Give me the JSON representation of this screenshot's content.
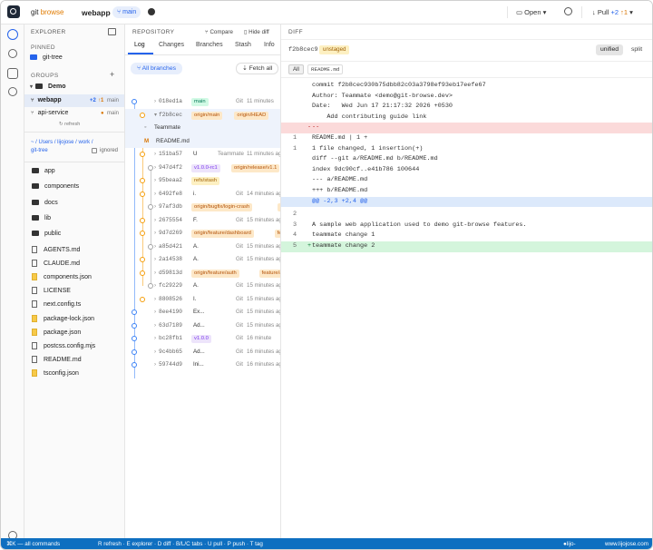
{
  "topbar": {
    "brand_a": "git",
    "brand_b": "browse",
    "repo": "webapp",
    "branch": "main",
    "open": "Open",
    "pull": "Pull",
    "ahead": "+2",
    "behind": "↑1"
  },
  "explorer": {
    "title": "EXPLORER",
    "pinned_label": "PINNED",
    "pinned": "git-tree",
    "groups_label": "GROUPS",
    "group": "Demo",
    "repos": [
      {
        "name": "webapp",
        "ahead": "+2",
        "behind": "↑1",
        "branch": "main"
      },
      {
        "name": "api-service",
        "branch": "main"
      }
    ],
    "refresh": "refresh",
    "path": "~ / Users / lijojose / work / git-tree",
    "ignored": "ignored",
    "folders": [
      "app",
      "components",
      "docs",
      "lib",
      "public"
    ],
    "files": [
      {
        "n": "AGENTS.md",
        "y": false
      },
      {
        "n": "CLAUDE.md",
        "y": false
      },
      {
        "n": "components.json",
        "y": true
      },
      {
        "n": "LICENSE",
        "y": false
      },
      {
        "n": "next.config.ts",
        "y": false
      },
      {
        "n": "package-lock.json",
        "y": true
      },
      {
        "n": "package.json",
        "y": true
      },
      {
        "n": "postcss.config.mjs",
        "y": false
      },
      {
        "n": "README.md",
        "y": false
      },
      {
        "n": "tsconfig.json",
        "y": true
      }
    ]
  },
  "repository": {
    "title": "REPOSITORY",
    "compare": "Compare",
    "hide_diff": "Hide diff",
    "tabs": [
      "Log",
      "Changes",
      "Branches",
      "Stash",
      "Info"
    ],
    "all_branches": "All branches",
    "fetch_all": "Fetch all",
    "commits": [
      {
        "hash": "018ed1a",
        "tags": [
          {
            "t": "main",
            "c": "gr"
          }
        ],
        "msg": "",
        "au": "Git",
        "tm": "11 minutes"
      },
      {
        "hash": "f2b8cec",
        "tags": [
          {
            "t": "origin/main",
            "c": "or"
          },
          {
            "t": "origin/HEAD",
            "c": "or"
          }
        ],
        "msg": "",
        "au": "",
        "tm": "",
        "open": true
      },
      {
        "hash": "151ba57",
        "tags": [],
        "msg": "U",
        "au": "Teammate",
        "tm": "11 minutes ago"
      },
      {
        "hash": "947d4f2",
        "tags": [
          {
            "t": "v1.0.0-rc1",
            "c": "pu"
          },
          {
            "t": "origin/release/v1.1",
            "c": "or"
          }
        ],
        "msg": "",
        "au": "",
        "tm": ""
      },
      {
        "hash": "95beaa2",
        "tags": [
          {
            "t": "refs/stash",
            "c": "ye"
          }
        ],
        "msg": "",
        "au": "",
        "tm": ""
      },
      {
        "hash": "6492fe8",
        "tags": [],
        "msg": "i.",
        "au": "Git",
        "tm": "14 minutes ago"
      },
      {
        "hash": "97af3db",
        "tags": [
          {
            "t": "origin/bugfix/login-crash",
            "c": "or"
          },
          {
            "t": "bugfi",
            "c": "or"
          }
        ],
        "msg": "",
        "au": "",
        "tm": ""
      },
      {
        "hash": "2675554",
        "tags": [],
        "msg": "F.",
        "au": "Git",
        "tm": "15 minutes ago"
      },
      {
        "hash": "9d7d269",
        "tags": [
          {
            "t": "origin/feature/dashboard",
            "c": "or"
          },
          {
            "t": "featur",
            "c": "or"
          }
        ],
        "msg": "",
        "au": "",
        "tm": ""
      },
      {
        "hash": "a85d421",
        "tags": [],
        "msg": "A.",
        "au": "Git",
        "tm": "15 minutes ago"
      },
      {
        "hash": "2a14538",
        "tags": [],
        "msg": "A.",
        "au": "Git",
        "tm": "15 minutes ago"
      },
      {
        "hash": "d59813d",
        "tags": [
          {
            "t": "origin/feature/auth",
            "c": "or"
          },
          {
            "t": "feature/aut",
            "c": "or"
          }
        ],
        "msg": "",
        "au": "",
        "tm": ""
      },
      {
        "hash": "fc29229",
        "tags": [],
        "msg": "A.",
        "au": "Git",
        "tm": "15 minutes ago"
      },
      {
        "hash": "8808526",
        "tags": [],
        "msg": "I.",
        "au": "Git",
        "tm": "15 minutes ago"
      },
      {
        "hash": "8ee4190",
        "tags": [],
        "msg": "Ex...",
        "au": "Git",
        "tm": "15 minutes ago"
      },
      {
        "hash": "63d7189",
        "tags": [],
        "msg": "Ad...",
        "au": "Git",
        "tm": "15 minutes ago"
      },
      {
        "hash": "bc28fb1",
        "tags": [
          {
            "t": "v1.0.0",
            "c": "pu"
          }
        ],
        "msg": "",
        "au": "Git",
        "tm": "16 minute"
      },
      {
        "hash": "9c4bb65",
        "tags": [],
        "msg": "Ad...",
        "au": "Git",
        "tm": "16 minutes ago"
      },
      {
        "hash": "59744d9",
        "tags": [],
        "msg": "Ini...",
        "au": "Git",
        "tm": "16 minutes ago"
      }
    ],
    "expanded_author": "Teammate",
    "expanded_file": "README.md"
  },
  "diff": {
    "title": "DIFF",
    "hash": "f2b8cec9",
    "badge": "unstaged",
    "unified": "unified",
    "split": "split",
    "all": "All",
    "file": "README.md",
    "lines": [
      {
        "n": "",
        "t": "commit f2b8cec930b75dbb82c03a3798ef93eb17eefe67",
        "k": ""
      },
      {
        "n": "",
        "t": "Author: Teammate <demo@git-browse.dev>",
        "k": ""
      },
      {
        "n": "",
        "t": "Date:   Wed Jun 17 21:17:32 2026 +0530",
        "k": ""
      },
      {
        "n": "",
        "t": "    Add contributing guide link",
        "k": ""
      },
      {
        "n": "",
        "t": "--",
        "k": "del"
      },
      {
        "n": "1",
        "t": "README.md | 1 +",
        "k": ""
      },
      {
        "n": "1",
        "t": "1 file changed, 1 insertion(+)",
        "k": ""
      },
      {
        "n": "",
        "t": "diff --git a/README.md b/README.md",
        "k": ""
      },
      {
        "n": "",
        "t": "index 9dc90cf..e41b786 100644",
        "k": ""
      },
      {
        "n": "",
        "t": "--- a/README.md",
        "k": ""
      },
      {
        "n": "",
        "t": "+++ b/README.md",
        "k": ""
      },
      {
        "n": "",
        "t": "@@ -2,3 +2,4 @@",
        "k": "hunk"
      },
      {
        "n": "2",
        "t": "",
        "k": ""
      },
      {
        "n": "3",
        "t": "A sample web application used to demo git-browse features.",
        "k": ""
      },
      {
        "n": "4",
        "t": "teammate change 1",
        "k": ""
      },
      {
        "n": "5",
        "t": "teammate change 2",
        "k": "add"
      }
    ]
  },
  "status": {
    "left": "⌘K — all commands",
    "keys": "R refresh · E explorer · D diff · B/L/C tabs · U pull · P push · T tag",
    "user": "lijo-jose",
    "site": "www.lijojose.com"
  },
  "colors": {
    "accent": "#2563eb",
    "status_bar": "#0e6fc0",
    "add_bg": "#d4f5dc",
    "del_bg": "#fbdada",
    "hunk_bg": "#dce9fb"
  }
}
